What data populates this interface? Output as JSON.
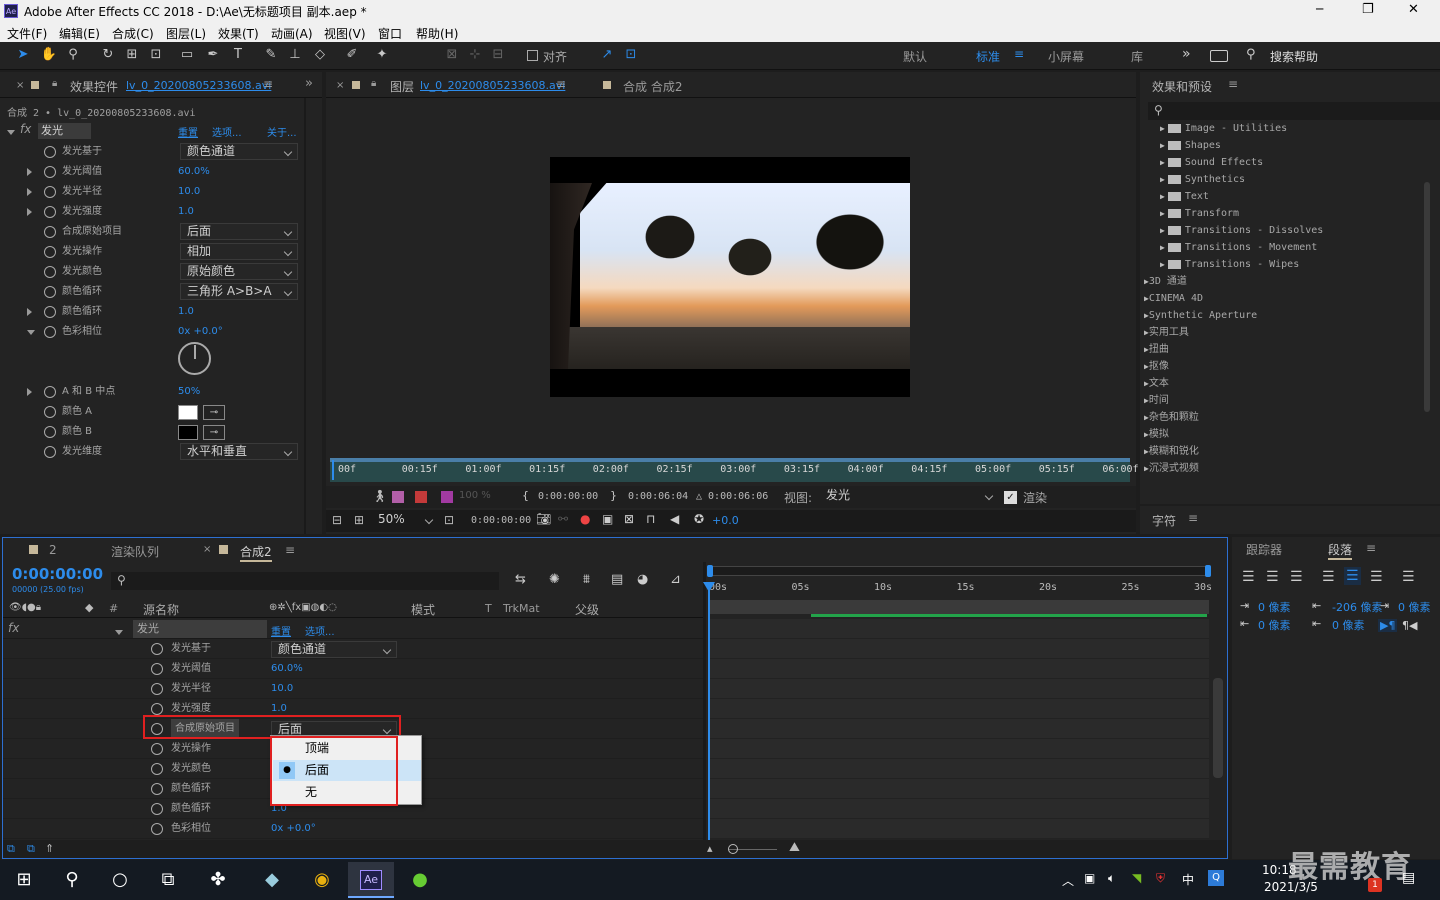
{
  "window": {
    "title": "Adobe After Effects CC 2018 - D:\\Ae\\无标题项目 副本.aep *",
    "minimize": "─",
    "restore": "❐",
    "close": "✕"
  },
  "menu": [
    "文件(F)",
    "编辑(E)",
    "合成(C)",
    "图层(L)",
    "效果(T)",
    "动画(A)",
    "视图(V)",
    "窗口",
    "帮助(H)"
  ],
  "toolbar": {
    "snap": "对齐",
    "workspaces": [
      "默认",
      "标准",
      "小屏幕",
      "库"
    ],
    "active_workspace": "标准",
    "search_placeholder": "搜索帮助",
    "more": "»"
  },
  "effect_controls": {
    "tab": "效果控件",
    "layer_name": "lv_0_20200805233608.avi",
    "breadcrumb": "合成 2 • lv_0_20200805233608.avi",
    "effect": "发光",
    "reset": "重置",
    "options": "选项...",
    "about": "关于...",
    "props": [
      {
        "label": "发光基于",
        "value": "颜色通道",
        "type": "dropdown"
      },
      {
        "label": "发光阈值",
        "value": "60.0%",
        "type": "number"
      },
      {
        "label": "发光半径",
        "value": "10.0",
        "type": "number"
      },
      {
        "label": "发光强度",
        "value": "1.0",
        "type": "number"
      },
      {
        "label": "合成原始项目",
        "value": "后面",
        "type": "dropdown"
      },
      {
        "label": "发光操作",
        "value": "相加",
        "type": "dropdown"
      },
      {
        "label": "发光颜色",
        "value": "原始颜色",
        "type": "dropdown"
      },
      {
        "label": "颜色循环",
        "value": "三角形 A>B>A",
        "type": "dropdown"
      },
      {
        "label": "颜色循环",
        "value": "1.0",
        "type": "number"
      },
      {
        "label": "色彩相位",
        "value": "0x +0.0°",
        "type": "number"
      },
      {
        "label": "A 和 B 中点",
        "value": "50%",
        "type": "number"
      },
      {
        "label": "颜色 A",
        "value": "",
        "type": "color",
        "color": "#ffffff"
      },
      {
        "label": "颜色 B",
        "value": "",
        "type": "color",
        "color": "#000000"
      },
      {
        "label": "发光维度",
        "value": "水平和垂直",
        "type": "dropdown"
      }
    ]
  },
  "viewer": {
    "layer_tab": "图层",
    "layer_name": "lv_0_20200805233608.avi",
    "comp_tab": "合成 合成2",
    "ruler": [
      "00f",
      "00:15f",
      "01:00f",
      "01:15f",
      "02:00f",
      "02:15f",
      "03:00f",
      "03:15f",
      "04:00f",
      "04:15f",
      "05:00f",
      "05:15f",
      "06:00f"
    ],
    "in_time": "0:00:00:00",
    "out_time": "0:00:06:04",
    "duration": "△ 0:00:06:06",
    "view_label": "视图:",
    "view_value": "发光",
    "render": "渲染",
    "zoom": "50%",
    "current": "0:00:00:00",
    "exposure": "+0.0",
    "opacity": "100 %"
  },
  "effects_presets": {
    "title": "效果和预设",
    "search_placeholder": "",
    "items": [
      {
        "label": "Image - Utilities",
        "level": 1
      },
      {
        "label": "Shapes",
        "level": 1
      },
      {
        "label": "Sound Effects",
        "level": 1
      },
      {
        "label": "Synthetics",
        "level": 1
      },
      {
        "label": "Text",
        "level": 1
      },
      {
        "label": "Transform",
        "level": 1
      },
      {
        "label": "Transitions - Dissolves",
        "level": 1
      },
      {
        "label": "Transitions - Movement",
        "level": 1
      },
      {
        "label": "Transitions - Wipes",
        "level": 1
      },
      {
        "label": "3D 通道",
        "level": 0
      },
      {
        "label": "CINEMA 4D",
        "level": 0
      },
      {
        "label": "Synthetic Aperture",
        "level": 0
      },
      {
        "label": "实用工具",
        "level": 0
      },
      {
        "label": "扭曲",
        "level": 0
      },
      {
        "label": "抠像",
        "level": 0
      },
      {
        "label": "文本",
        "level": 0
      },
      {
        "label": "时间",
        "level": 0
      },
      {
        "label": "杂色和颗粒",
        "level": 0
      },
      {
        "label": "模拟",
        "level": 0
      },
      {
        "label": "模糊和锐化",
        "level": 0
      },
      {
        "label": "沉浸式视频",
        "level": 0
      }
    ]
  },
  "character": {
    "title": "字符"
  },
  "timeline": {
    "tabs": [
      "2",
      "渲染队列",
      "合成2"
    ],
    "timecode": "0:00:00:00",
    "fps": "00000 (25.00 fps)",
    "cols": {
      "source": "源名称",
      "mode": "模式",
      "t": "T",
      "trkmat": "TrkMat",
      "parent": "父级",
      "num": "#"
    },
    "effect": "发光",
    "reset": "重置",
    "options": "选项...",
    "props": [
      {
        "label": "发光基于",
        "value": "颜色通道",
        "type": "dropdown"
      },
      {
        "label": "发光阈值",
        "value": "60.0%"
      },
      {
        "label": "发光半径",
        "value": "10.0"
      },
      {
        "label": "发光强度",
        "value": "1.0"
      },
      {
        "label": "合成原始项目",
        "value": "后面",
        "type": "dropdown"
      },
      {
        "label": "发光操作",
        "value": ""
      },
      {
        "label": "发光颜色",
        "value": ""
      },
      {
        "label": "颜色循环",
        "value": ""
      },
      {
        "label": "颜色循环",
        "value": "1.0"
      },
      {
        "label": "色彩相位",
        "value": "0x +0.0°"
      }
    ],
    "ruler": [
      "00s",
      "05s",
      "10s",
      "15s",
      "20s",
      "25s",
      "30s"
    ],
    "menu_options": [
      {
        "label": "顶端",
        "selected": false
      },
      {
        "label": "后面",
        "selected": true
      },
      {
        "label": "无",
        "selected": false
      }
    ]
  },
  "paragraph": {
    "tracker_tab": "跟踪器",
    "paragraph_tab": "段落",
    "f1": "0 像素",
    "f2": "-206 像素",
    "f3": "0 像素",
    "f4": "0 像素",
    "f5": "0 像素"
  },
  "taskbar": {
    "time": "10:18",
    "date": "2021/3/5",
    "ime": "中",
    "badge": "1",
    "watermark": "最需教育"
  }
}
